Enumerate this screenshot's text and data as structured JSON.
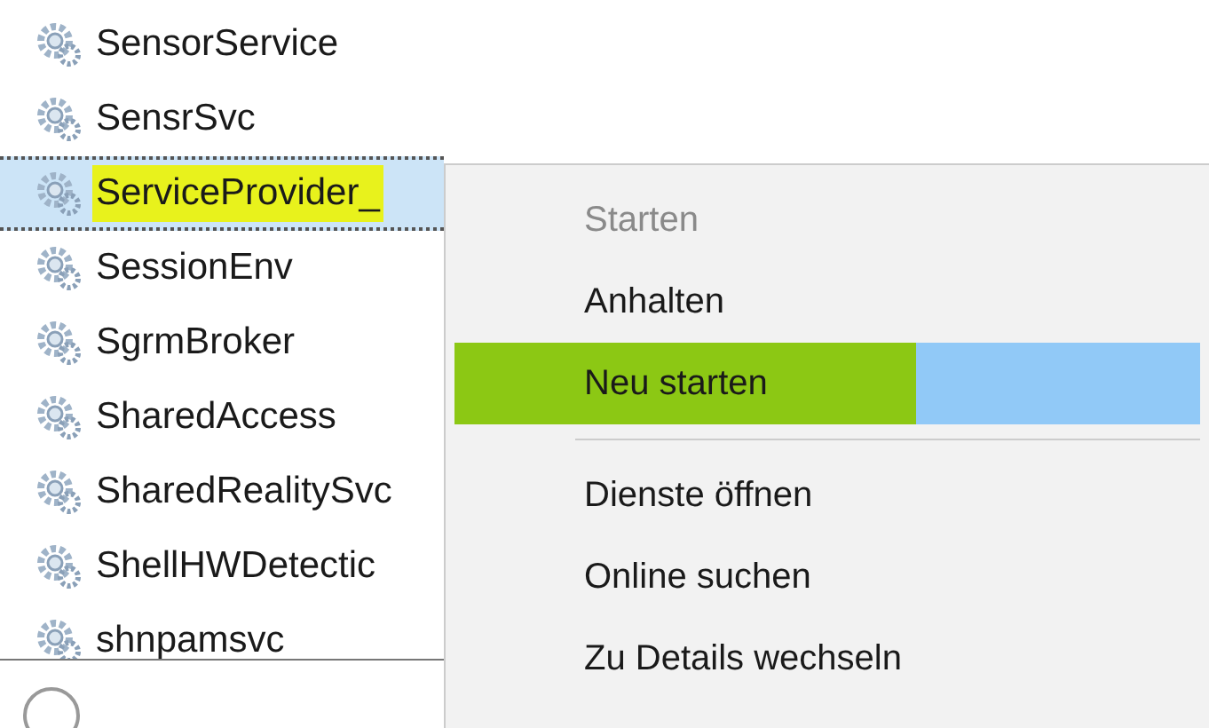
{
  "services": [
    {
      "name": "SensorService",
      "selected": false
    },
    {
      "name": "SensrSvc",
      "selected": false
    },
    {
      "name": "ServiceProvider_",
      "selected": true,
      "color": "#e8f21c"
    },
    {
      "name": "SessionEnv",
      "selected": false
    },
    {
      "name": "SgrmBroker",
      "selected": false
    },
    {
      "name": "SharedAccess",
      "selected": false
    },
    {
      "name": "SharedRealitySvc",
      "selected": false
    },
    {
      "name": "ShellHWDetectic",
      "selected": false
    },
    {
      "name": "shnpamsvc",
      "selected": false
    }
  ],
  "context_menu": {
    "items": [
      {
        "kind": "item",
        "label": "Starten",
        "disabled": true,
        "selected": false
      },
      {
        "kind": "item",
        "label": "Anhalten",
        "disabled": false,
        "selected": false
      },
      {
        "kind": "item",
        "label": "Neu starten",
        "disabled": false,
        "selected": true,
        "color": "#8cc814"
      },
      {
        "kind": "separator"
      },
      {
        "kind": "item",
        "label": "Dienste öffnen",
        "disabled": false,
        "selected": false
      },
      {
        "kind": "item",
        "label": "Online suchen",
        "disabled": false,
        "selected": false
      },
      {
        "kind": "item",
        "label": "Zu Details wechseln",
        "disabled": false,
        "selected": false
      }
    ]
  }
}
